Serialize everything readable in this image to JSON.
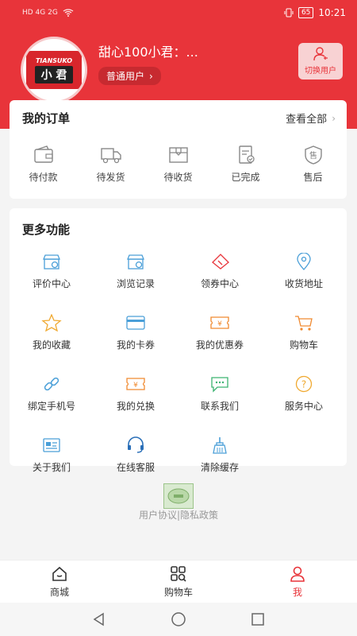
{
  "status_bar": {
    "left_indicators": "HD 4G 2G",
    "battery": "65",
    "time": "10:21"
  },
  "profile": {
    "avatar_brand": "TIANSUKO",
    "avatar_text": "小 君",
    "name": "甜心100小君：...",
    "level": "普通用户",
    "level_chevron": "›",
    "switch_label": "切换用户"
  },
  "orders": {
    "title": "我的订单",
    "view_all": "查看全部",
    "view_all_chevron": "›",
    "items": [
      {
        "label": "待付款",
        "icon": "wallet-icon"
      },
      {
        "label": "待发货",
        "icon": "truck-icon"
      },
      {
        "label": "待收货",
        "icon": "package-icon"
      },
      {
        "label": "已完成",
        "icon": "clipboard-check-icon"
      },
      {
        "label": "售后",
        "icon": "shield-shou-icon",
        "glyph": "售"
      }
    ]
  },
  "more_functions": {
    "title": "更多功能",
    "items": [
      {
        "label": "评价中心",
        "icon": "shop-gear-icon",
        "color": "#4a9fd8"
      },
      {
        "label": "浏览记录",
        "icon": "shop-gear-icon",
        "color": "#4a9fd8"
      },
      {
        "label": "领券中心",
        "icon": "ticket-icon",
        "color": "#e8343a"
      },
      {
        "label": "收货地址",
        "icon": "location-pin-icon",
        "color": "#4a9fd8"
      },
      {
        "label": "我的收藏",
        "icon": "star-icon",
        "color": "#f0a930"
      },
      {
        "label": "我的卡券",
        "icon": "card-icon",
        "color": "#4a9fd8"
      },
      {
        "label": "我的优惠券",
        "icon": "coupon-icon",
        "color": "#f08a30",
        "glyph": "¥"
      },
      {
        "label": "购物车",
        "icon": "cart-icon",
        "color": "#f08a30"
      },
      {
        "label": "绑定手机号",
        "icon": "link-icon",
        "color": "#4a9fd8"
      },
      {
        "label": "我的兑换",
        "icon": "exchange-icon",
        "color": "#f08a30",
        "glyph": "¥"
      },
      {
        "label": "联系我们",
        "icon": "chat-icon",
        "color": "#3cb371"
      },
      {
        "label": "服务中心",
        "icon": "help-icon",
        "color": "#f0a930",
        "glyph": "?"
      },
      {
        "label": "关于我们",
        "icon": "id-card-icon",
        "color": "#4a9fd8"
      },
      {
        "label": "在线客服",
        "icon": "headset-icon",
        "color": "#2a6fb8"
      },
      {
        "label": "清除缓存",
        "icon": "broom-icon",
        "color": "#4a9fd8"
      }
    ]
  },
  "footer": {
    "links": "用户协议|隐私政策"
  },
  "tabs": [
    {
      "label": "商城",
      "icon": "home-icon"
    },
    {
      "label": "购物车",
      "icon": "grid-search-icon"
    },
    {
      "label": "我",
      "icon": "person-icon",
      "active": true
    }
  ],
  "colors": {
    "brand_red": "#e8343a",
    "background": "#f4f4f4"
  }
}
